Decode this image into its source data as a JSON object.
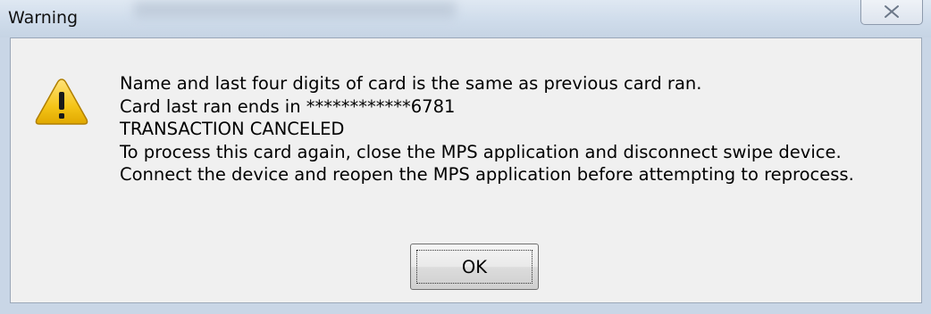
{
  "window": {
    "title": "Warning"
  },
  "dialog": {
    "icon": "warning-icon",
    "message_lines": [
      "Name and last four digits of card is the same as previous card ran.",
      "Card last ran ends in ************6781",
      "TRANSACTION CANCELED",
      "To process this card again, close the MPS application and disconnect swipe device.",
      "Connect the device and reopen the MPS application before attempting to reprocess."
    ],
    "ok_label": "OK"
  },
  "colors": {
    "titlebar": "#cfdceb",
    "client_bg": "#f0f0f0",
    "warning_yellow": "#f5c518"
  }
}
